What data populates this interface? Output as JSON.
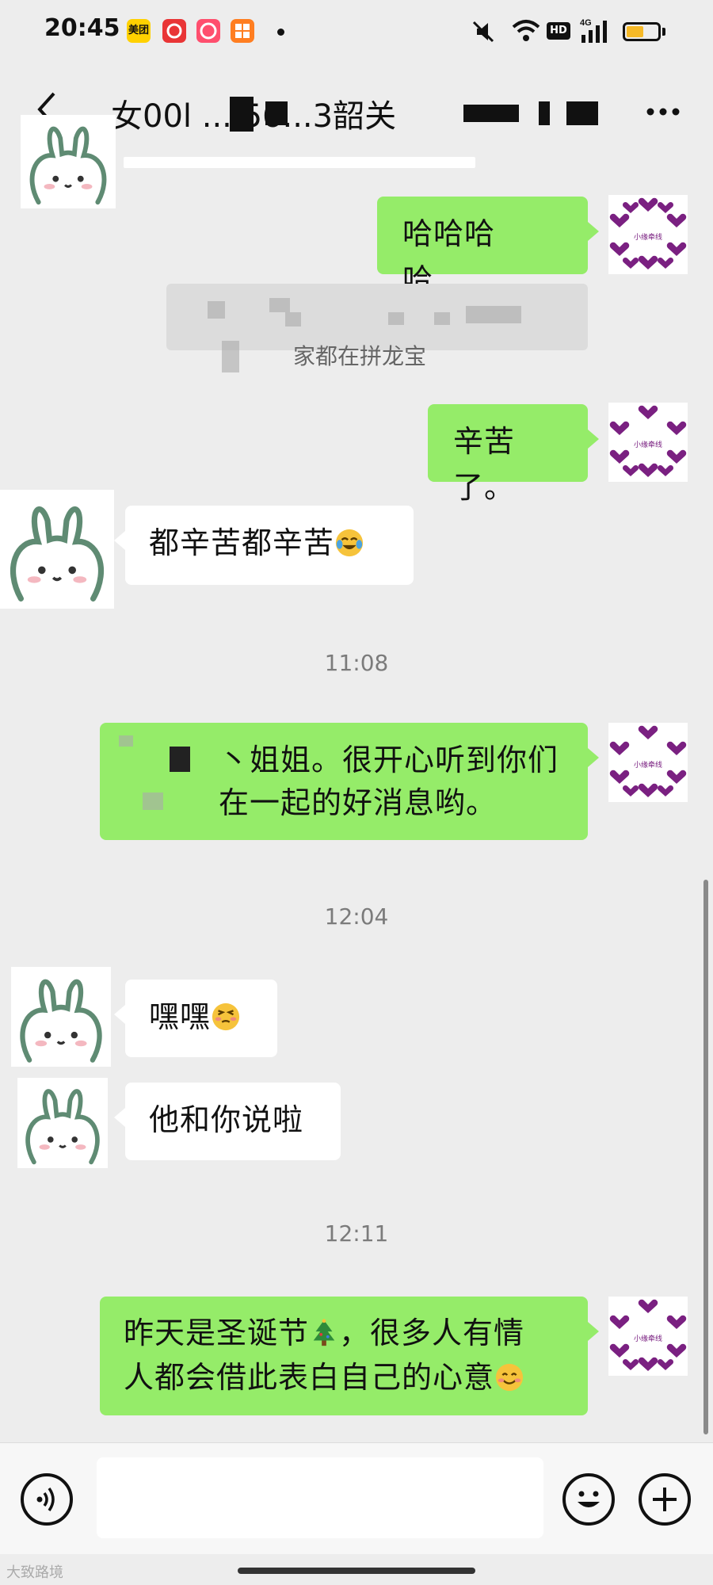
{
  "status_bar": {
    "time": "20:45",
    "app_badge": "美团",
    "hd": "HD",
    "network": "4G",
    "battery_level": 0.55,
    "icons": [
      "meituan-app-icon",
      "netease-music-icon",
      "pink-app-icon",
      "orange-app-icon",
      "mute-icon",
      "wifi-icon",
      "signal-icon",
      "battery-icon"
    ]
  },
  "header": {
    "title": "女00l ... 56...3韶关",
    "back_icon": "chevron-left-icon",
    "more_icon": "more-dots-icon"
  },
  "chat": {
    "quote_text": "家都在拼龙宝",
    "messages": [
      {
        "side": "out",
        "text": "哈哈哈哈...."
      },
      {
        "side": "out",
        "text": "辛苦了。"
      },
      {
        "side": "in",
        "text": "都辛苦都辛苦",
        "emoji": "crying-laughing-emoji"
      },
      {
        "side": "out",
        "text": "丶姐姐。很开心听到你们在一起的好消息哟。"
      },
      {
        "side": "in",
        "text": "嘿嘿",
        "emoji": "shy-face-emoji"
      },
      {
        "side": "in",
        "text": "他和你说啦"
      },
      {
        "side": "out",
        "line1": "昨天是圣诞节",
        "line1_tail": "，很多人有情",
        "line2": "人都会借此表白自己的心意",
        "emojis": [
          "christmas-tree-emoji",
          "smile-emoji"
        ]
      }
    ],
    "timestamps": [
      "11:08",
      "12:04",
      "12:11"
    ]
  },
  "self_avatar_label": "小缘牵线",
  "input_bar": {
    "voice_icon": "voice-icon",
    "emoji_icon": "emoji-face-icon",
    "plus_icon": "plus-icon",
    "placeholder": ""
  },
  "watermark": "大致路境",
  "colors": {
    "background": "#ededed",
    "outgoing_bubble": "#95ec69",
    "incoming_bubble": "#ffffff",
    "heart": "#7a2081"
  }
}
